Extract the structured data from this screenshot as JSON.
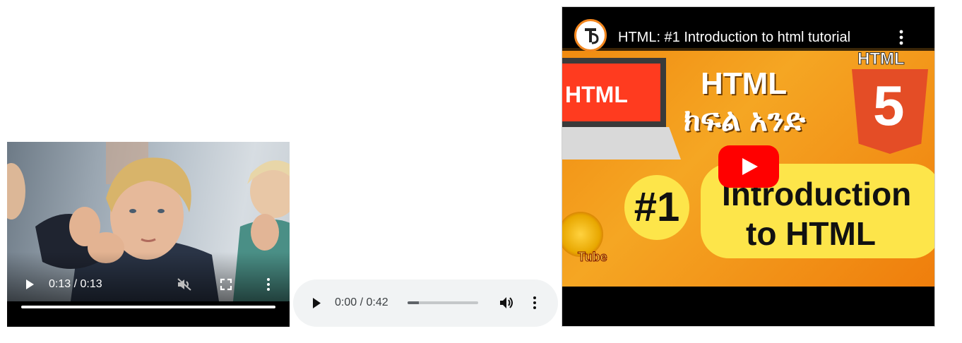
{
  "video": {
    "current_time": "0:13",
    "duration": "0:13",
    "time_label": "0:13 / 0:13",
    "progress_fraction": 1.0,
    "muted": true,
    "icons": {
      "play": "play-icon",
      "mute": "volume-muted-icon",
      "fullscreen": "fullscreen-icon",
      "more": "more-vert-icon"
    }
  },
  "audio": {
    "current_time": "0:00",
    "duration": "0:42",
    "time_label": "0:00 / 0:42",
    "progress_fraction": 0.16,
    "icons": {
      "play": "play-icon",
      "volume": "volume-icon",
      "more": "more-vert-icon"
    }
  },
  "youtube": {
    "title": "HTML: #1 Introduction to html tutorial",
    "thumbnail": {
      "laptop_label": "HTML",
      "heading_top": "HTML",
      "heading_amharic": "ክፍል አንድ",
      "badge_label": "HTML",
      "number": "#1",
      "intro_line1": "Introduction",
      "intro_line2": "to HTML",
      "channel_text": "Tube"
    },
    "icons": {
      "avatar": "channel-avatar",
      "more": "more-vert-icon",
      "play": "youtube-play-button"
    },
    "colors": {
      "play_button": "#ff0000",
      "thumbnail_bg": "#f5a623",
      "html5_shield": "#e44d26",
      "pill": "#fde54a"
    }
  }
}
